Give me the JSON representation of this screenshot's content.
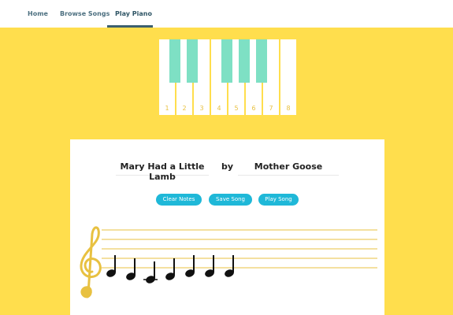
{
  "nav": {
    "items": [
      {
        "label": "Home"
      },
      {
        "label": "Browse Songs"
      },
      {
        "label": "Play Piano"
      }
    ],
    "active": "Play Piano"
  },
  "piano": {
    "keys": [
      "1",
      "2",
      "3",
      "4",
      "5",
      "6",
      "7",
      "8"
    ],
    "colors": {
      "black_key": "#7ee0c4",
      "number": "#e8c141"
    }
  },
  "song": {
    "title": "Mary Had a Little Lamb",
    "by": "by",
    "author": "Mother Goose"
  },
  "buttons": {
    "clear": "Clear Notes",
    "save": "Save Song",
    "play": "Play Song"
  },
  "staff": {
    "clef": "treble-clef",
    "notes": [
      "E",
      "D",
      "C",
      "D",
      "E",
      "E",
      "E"
    ]
  },
  "colors": {
    "background": "#ffde4d",
    "button": "#1fb8d8",
    "nav_text": "#4d7080",
    "clef": "#e8c141"
  }
}
